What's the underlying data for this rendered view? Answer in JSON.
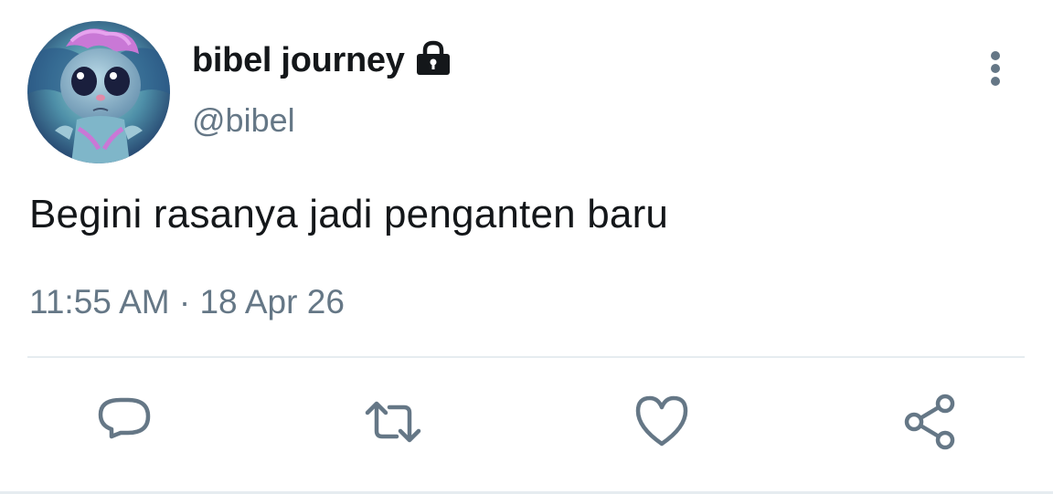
{
  "user": {
    "display_name": "bibel journey",
    "handle": "@bibel",
    "protected": true
  },
  "tweet": {
    "text": "Begini rasanya jadi penganten baru",
    "time": "11:55 AM",
    "separator": " · ",
    "date": "18 Apr 26"
  },
  "icons": {
    "lock": "lock-icon",
    "more": "more-vertical-icon",
    "reply": "reply-icon",
    "retweet": "retweet-icon",
    "like": "heart-icon",
    "share": "share-icon"
  },
  "colors": {
    "text_primary": "#14171a",
    "text_secondary": "#657786",
    "divider": "#e6ecf0"
  }
}
